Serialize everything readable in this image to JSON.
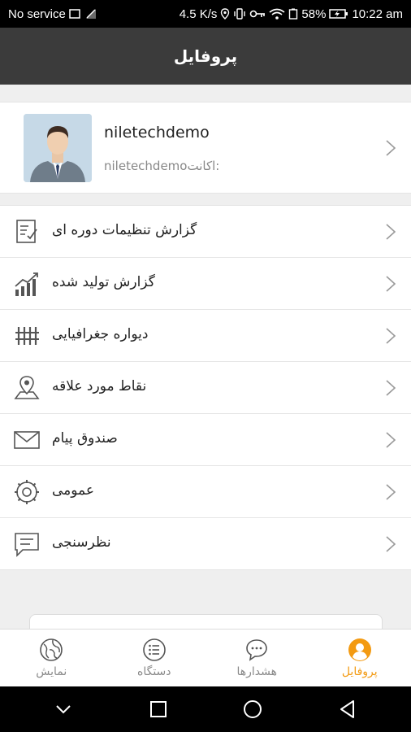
{
  "status_bar": {
    "carrier": "No service",
    "speed": "4.5 K/s",
    "battery": "58%",
    "time": "10:22 am"
  },
  "header": {
    "title": "پروفایل"
  },
  "profile": {
    "username": "niletechdemo",
    "account_label": "اکانت:",
    "account_value": "niletechdemo"
  },
  "menu": {
    "items": [
      {
        "label": "گزارش تنظیمات دوره ای",
        "icon": "report-settings-icon"
      },
      {
        "label": "گزارش تولید شده",
        "icon": "chart-trend-icon"
      },
      {
        "label": "دیواره جغرافیایی",
        "icon": "geofence-icon"
      },
      {
        "label": "نقاط مورد علاقه",
        "icon": "map-pin-icon"
      },
      {
        "label": "صندوق پیام",
        "icon": "envelope-icon"
      },
      {
        "label": "عمومی",
        "icon": "gear-icon"
      },
      {
        "label": "نظرسنجی",
        "icon": "feedback-icon"
      }
    ]
  },
  "bottom_nav": {
    "tabs": [
      {
        "label": "نمایش",
        "icon": "map-globe-icon"
      },
      {
        "label": "دستگاه",
        "icon": "list-icon"
      },
      {
        "label": "هشدارها",
        "icon": "chat-bubble-icon"
      },
      {
        "label": "پروفایل",
        "icon": "person-icon",
        "active": true
      }
    ]
  },
  "colors": {
    "header_bg": "#3b3b3b",
    "active_tab": "#f39a11",
    "inactive_tab": "#8a8a8a"
  }
}
